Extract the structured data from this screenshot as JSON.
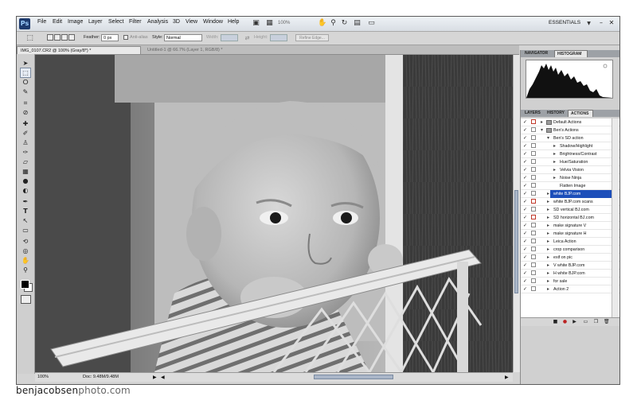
{
  "app": {
    "logo": "Ps",
    "workspace": "ESSENTIALS"
  },
  "menus": [
    "File",
    "Edit",
    "Image",
    "Layer",
    "Select",
    "Filter",
    "Analysis",
    "3D",
    "View",
    "Window",
    "Help"
  ],
  "menubar_zoom": "100%",
  "options": {
    "feather_label": "Feather:",
    "feather_value": "0 px",
    "antialias_label": "Anti-alias",
    "style_label": "Style:",
    "style_value": "Normal",
    "width_label": "Width:",
    "height_label": "Height:",
    "refine_label": "Refine Edge..."
  },
  "tabs": [
    {
      "label": "IMG_0107.CR2 @ 100% (Gray/8*) *",
      "active": true
    },
    {
      "label": "Untitled-1 @ 66.7% (Layer 1, RGB/8) *",
      "active": false
    }
  ],
  "status": {
    "zoom": "100%",
    "doc": "Doc: 9.48M/9.48M"
  },
  "panels": {
    "top_tabs": [
      "NAVIGATOR",
      "HISTOGRAM"
    ],
    "top_active": "HISTOGRAM",
    "mid_tabs": [
      "LAYERS",
      "HISTORY",
      "ACTIONS"
    ],
    "mid_active": "ACTIONS"
  },
  "actions": [
    {
      "label": "Default Actions",
      "level": 0,
      "type": "set",
      "open": false,
      "checked": true,
      "dialog_red": true
    },
    {
      "label": "Ben's Actions",
      "level": 0,
      "type": "set",
      "open": true,
      "checked": true,
      "dialog_red": false
    },
    {
      "label": "Ben's SD action",
      "level": 1,
      "type": "action",
      "open": true,
      "checked": true
    },
    {
      "label": "Shadow/Highlight",
      "level": 2,
      "type": "step",
      "checked": true
    },
    {
      "label": "Brightness/Contrast",
      "level": 2,
      "type": "step",
      "checked": true
    },
    {
      "label": "Hue/Saturation",
      "level": 2,
      "type": "step",
      "checked": true
    },
    {
      "label": "Velvia Vision",
      "level": 2,
      "type": "step",
      "checked": true
    },
    {
      "label": "Noise Ninja",
      "level": 2,
      "type": "step",
      "checked": true
    },
    {
      "label": "Flatten Image",
      "level": 2,
      "type": "step",
      "checked": true,
      "no_tri": true
    },
    {
      "label": "white BJP.com",
      "level": 1,
      "type": "action",
      "checked": true,
      "selected": true
    },
    {
      "label": "white BJP.com scans",
      "level": 1,
      "type": "action",
      "checked": true,
      "dialog_red": true
    },
    {
      "label": "SD vertical BJ.com",
      "level": 1,
      "type": "action",
      "checked": true
    },
    {
      "label": "SD horizontal BJ.com",
      "level": 1,
      "type": "action",
      "checked": true,
      "dialog_red": true
    },
    {
      "label": "make signature V",
      "level": 1,
      "type": "action",
      "checked": true
    },
    {
      "label": "make signature H",
      "level": 1,
      "type": "action",
      "checked": true
    },
    {
      "label": "Leica Action",
      "level": 1,
      "type": "action",
      "checked": true
    },
    {
      "label": "crop comparison",
      "level": 1,
      "type": "action",
      "checked": true
    },
    {
      "label": "exif on pic",
      "level": 1,
      "type": "action",
      "checked": true
    },
    {
      "label": "V white BJP.com",
      "level": 1,
      "type": "action",
      "checked": true
    },
    {
      "label": "H white BJP.com",
      "level": 1,
      "type": "action",
      "checked": true
    },
    {
      "label": "for sale",
      "level": 1,
      "type": "action",
      "checked": true
    },
    {
      "label": "Action 2",
      "level": 1,
      "type": "action",
      "checked": true
    }
  ],
  "colors": {
    "selection": "#1d4fba",
    "ps_blue": "#1e3b6e",
    "dialog_red": "#c0392b"
  },
  "icons": {
    "check": "✓"
  },
  "watermark": {
    "bold": "benjacobsen",
    "light": "photo.com"
  }
}
